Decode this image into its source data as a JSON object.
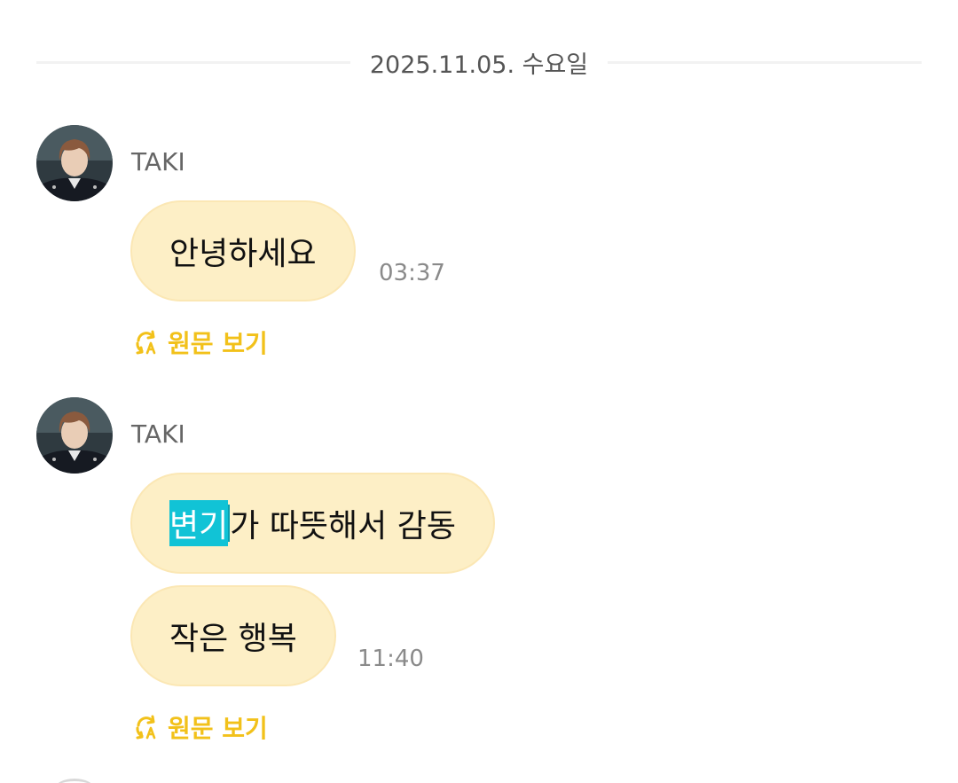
{
  "date_divider": "2025.11.05. 수요일",
  "messages": [
    {
      "sender": "TAKI",
      "bubbles": [
        {
          "text": "안녕하세요"
        }
      ],
      "time": "03:37",
      "translate_link": "원문 보기"
    },
    {
      "sender": "TAKI",
      "bubbles": [
        {
          "highlight": "변기",
          "text_rest": "가 따뜻해서 감동"
        },
        {
          "text": "작은 행복"
        }
      ],
      "time": "11:40",
      "translate_link": "원문 보기"
    }
  ],
  "icons": {
    "avatar": "profile-photo",
    "translate": "translate-refresh-icon"
  },
  "colors": {
    "bubble": "#fdefc6",
    "bubble_border": "#fbe7b4",
    "link": "#f2c11a",
    "selection": "#11c3d6",
    "timestamp": "#8a8a8a"
  }
}
